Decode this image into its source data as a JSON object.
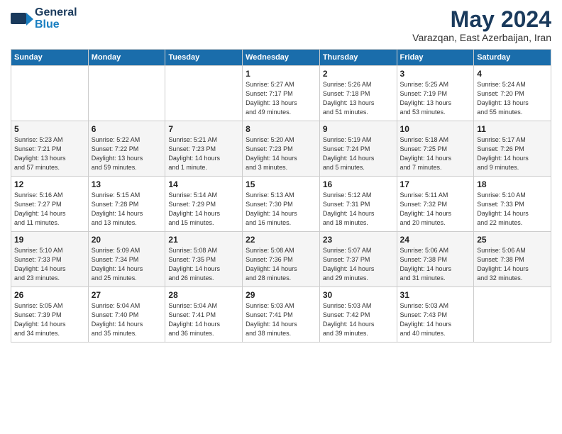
{
  "logo": {
    "line1": "General",
    "line2": "Blue"
  },
  "title": "May 2024",
  "location": "Varazqan, East Azerbaijan, Iran",
  "days_of_week": [
    "Sunday",
    "Monday",
    "Tuesday",
    "Wednesday",
    "Thursday",
    "Friday",
    "Saturday"
  ],
  "weeks": [
    [
      {
        "day": "",
        "info": ""
      },
      {
        "day": "",
        "info": ""
      },
      {
        "day": "",
        "info": ""
      },
      {
        "day": "1",
        "info": "Sunrise: 5:27 AM\nSunset: 7:17 PM\nDaylight: 13 hours\nand 49 minutes."
      },
      {
        "day": "2",
        "info": "Sunrise: 5:26 AM\nSunset: 7:18 PM\nDaylight: 13 hours\nand 51 minutes."
      },
      {
        "day": "3",
        "info": "Sunrise: 5:25 AM\nSunset: 7:19 PM\nDaylight: 13 hours\nand 53 minutes."
      },
      {
        "day": "4",
        "info": "Sunrise: 5:24 AM\nSunset: 7:20 PM\nDaylight: 13 hours\nand 55 minutes."
      }
    ],
    [
      {
        "day": "5",
        "info": "Sunrise: 5:23 AM\nSunset: 7:21 PM\nDaylight: 13 hours\nand 57 minutes."
      },
      {
        "day": "6",
        "info": "Sunrise: 5:22 AM\nSunset: 7:22 PM\nDaylight: 13 hours\nand 59 minutes."
      },
      {
        "day": "7",
        "info": "Sunrise: 5:21 AM\nSunset: 7:23 PM\nDaylight: 14 hours\nand 1 minute."
      },
      {
        "day": "8",
        "info": "Sunrise: 5:20 AM\nSunset: 7:23 PM\nDaylight: 14 hours\nand 3 minutes."
      },
      {
        "day": "9",
        "info": "Sunrise: 5:19 AM\nSunset: 7:24 PM\nDaylight: 14 hours\nand 5 minutes."
      },
      {
        "day": "10",
        "info": "Sunrise: 5:18 AM\nSunset: 7:25 PM\nDaylight: 14 hours\nand 7 minutes."
      },
      {
        "day": "11",
        "info": "Sunrise: 5:17 AM\nSunset: 7:26 PM\nDaylight: 14 hours\nand 9 minutes."
      }
    ],
    [
      {
        "day": "12",
        "info": "Sunrise: 5:16 AM\nSunset: 7:27 PM\nDaylight: 14 hours\nand 11 minutes."
      },
      {
        "day": "13",
        "info": "Sunrise: 5:15 AM\nSunset: 7:28 PM\nDaylight: 14 hours\nand 13 minutes."
      },
      {
        "day": "14",
        "info": "Sunrise: 5:14 AM\nSunset: 7:29 PM\nDaylight: 14 hours\nand 15 minutes."
      },
      {
        "day": "15",
        "info": "Sunrise: 5:13 AM\nSunset: 7:30 PM\nDaylight: 14 hours\nand 16 minutes."
      },
      {
        "day": "16",
        "info": "Sunrise: 5:12 AM\nSunset: 7:31 PM\nDaylight: 14 hours\nand 18 minutes."
      },
      {
        "day": "17",
        "info": "Sunrise: 5:11 AM\nSunset: 7:32 PM\nDaylight: 14 hours\nand 20 minutes."
      },
      {
        "day": "18",
        "info": "Sunrise: 5:10 AM\nSunset: 7:33 PM\nDaylight: 14 hours\nand 22 minutes."
      }
    ],
    [
      {
        "day": "19",
        "info": "Sunrise: 5:10 AM\nSunset: 7:33 PM\nDaylight: 14 hours\nand 23 minutes."
      },
      {
        "day": "20",
        "info": "Sunrise: 5:09 AM\nSunset: 7:34 PM\nDaylight: 14 hours\nand 25 minutes."
      },
      {
        "day": "21",
        "info": "Sunrise: 5:08 AM\nSunset: 7:35 PM\nDaylight: 14 hours\nand 26 minutes."
      },
      {
        "day": "22",
        "info": "Sunrise: 5:08 AM\nSunset: 7:36 PM\nDaylight: 14 hours\nand 28 minutes."
      },
      {
        "day": "23",
        "info": "Sunrise: 5:07 AM\nSunset: 7:37 PM\nDaylight: 14 hours\nand 29 minutes."
      },
      {
        "day": "24",
        "info": "Sunrise: 5:06 AM\nSunset: 7:38 PM\nDaylight: 14 hours\nand 31 minutes."
      },
      {
        "day": "25",
        "info": "Sunrise: 5:06 AM\nSunset: 7:38 PM\nDaylight: 14 hours\nand 32 minutes."
      }
    ],
    [
      {
        "day": "26",
        "info": "Sunrise: 5:05 AM\nSunset: 7:39 PM\nDaylight: 14 hours\nand 34 minutes."
      },
      {
        "day": "27",
        "info": "Sunrise: 5:04 AM\nSunset: 7:40 PM\nDaylight: 14 hours\nand 35 minutes."
      },
      {
        "day": "28",
        "info": "Sunrise: 5:04 AM\nSunset: 7:41 PM\nDaylight: 14 hours\nand 36 minutes."
      },
      {
        "day": "29",
        "info": "Sunrise: 5:03 AM\nSunset: 7:41 PM\nDaylight: 14 hours\nand 38 minutes."
      },
      {
        "day": "30",
        "info": "Sunrise: 5:03 AM\nSunset: 7:42 PM\nDaylight: 14 hours\nand 39 minutes."
      },
      {
        "day": "31",
        "info": "Sunrise: 5:03 AM\nSunset: 7:43 PM\nDaylight: 14 hours\nand 40 minutes."
      },
      {
        "day": "",
        "info": ""
      }
    ]
  ]
}
